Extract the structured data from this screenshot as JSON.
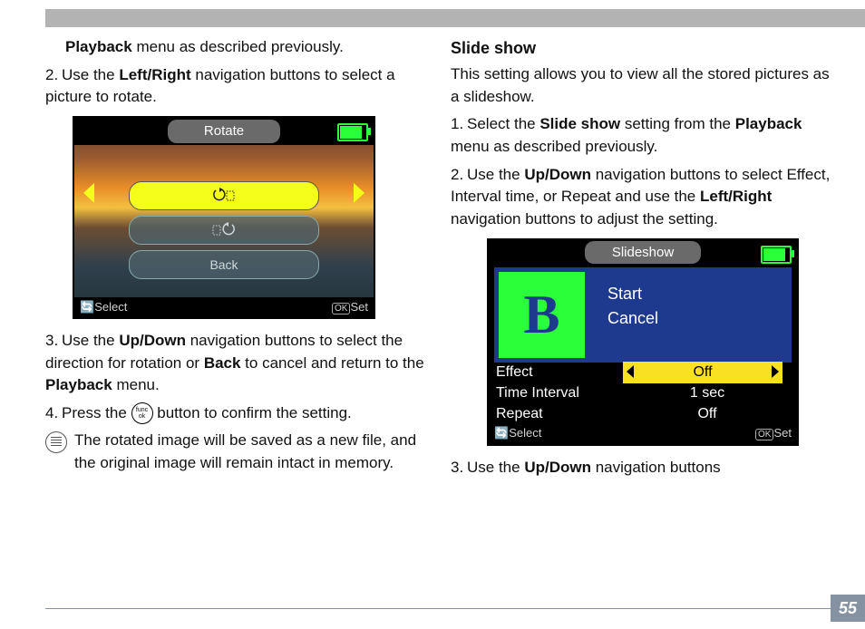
{
  "page_number": "55",
  "left": {
    "line1_a": "Playback",
    "line1_b": " menu as described previously.",
    "step2_pre": "2. ",
    "step2_a": "Use the ",
    "step2_b": "Left/Right",
    "step2_c": " navigation buttons to select a picture to rotate.",
    "rotate_screen": {
      "title": "Rotate",
      "back": "Back",
      "select": "Select",
      "ok": "OK",
      "set": "Set"
    },
    "step3_pre": "3. ",
    "step3_a": "Use the ",
    "step3_b": "Up/Down",
    "step3_c": " navigation buttons to select the direction for rotation or ",
    "step3_d": "Back",
    "step3_e": " to cancel and return to the ",
    "step3_f": "Playback",
    "step3_g": " menu.",
    "step4_pre": "4. ",
    "step4_a": "Press the ",
    "step4_icon": "func ok",
    "step4_b": " button to confirm the setting.",
    "note": "The rotated image will be saved as a new file, and the original image will remain intact in memory."
  },
  "right": {
    "heading": "Slide show",
    "intro": "This setting allows you to view all the stored pictures as a slideshow.",
    "step1_pre": "1. ",
    "step1_a": "Select the ",
    "step1_b": "Slide show",
    "step1_c": " setting from the ",
    "step1_d": "Playback",
    "step1_e": " menu as described previously.",
    "step2_pre": "2. ",
    "step2_a": "Use the ",
    "step2_b": "Up/Down",
    "step2_c": " navigation buttons to select Effect, Interval time, or Repeat and use the ",
    "step2_d": "Left/Right",
    "step2_e": " navigation buttons to adjust the setting.",
    "slide_screen": {
      "title": "Slideshow",
      "thumb": "B",
      "start": "Start",
      "cancel": "Cancel",
      "rows": [
        {
          "label": "Effect",
          "value": "Off",
          "highlight": true
        },
        {
          "label": "Time Interval",
          "value": "1 sec",
          "highlight": false
        },
        {
          "label": "Repeat",
          "value": "Off",
          "highlight": false
        }
      ],
      "select": "Select",
      "ok": "OK",
      "set": "Set"
    },
    "step3_pre": "3. ",
    "step3_a": "Use the ",
    "step3_b": "Up/Down",
    "step3_c": " navigation buttons"
  }
}
